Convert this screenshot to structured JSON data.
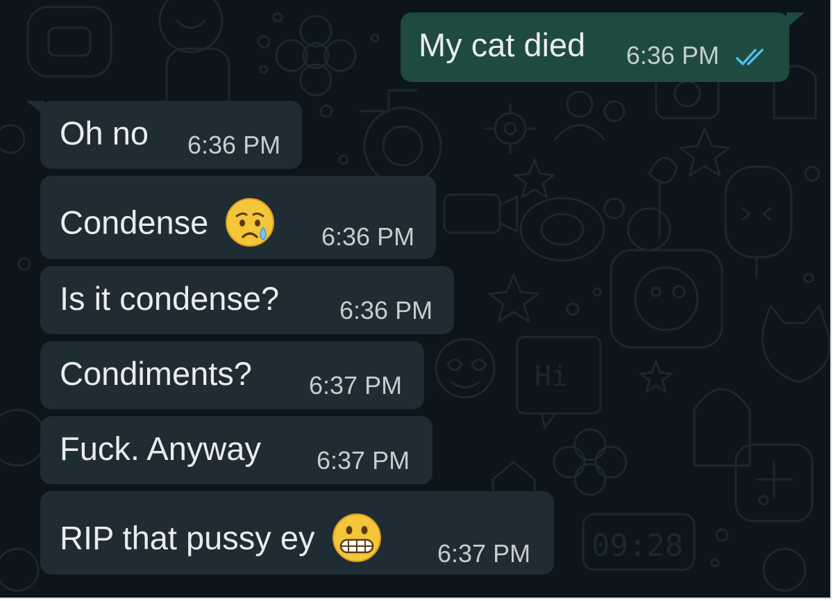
{
  "messages": [
    {
      "direction": "out",
      "text": "My cat died",
      "time": "6:36 PM",
      "status": "read",
      "status_icon": "double-check-icon",
      "status_color": "#53bdeb"
    },
    {
      "direction": "in",
      "text": "Oh no",
      "time": "6:36 PM"
    },
    {
      "direction": "in",
      "text": "Condense",
      "time": "6:36 PM",
      "emoji": "crying-face-emoji"
    },
    {
      "direction": "in",
      "text": "Is it condense?",
      "time": "6:36 PM"
    },
    {
      "direction": "in",
      "text": "Condiments?",
      "time": "6:37 PM"
    },
    {
      "direction": "in",
      "text": "Fuck. Anyway",
      "time": "6:37 PM"
    },
    {
      "direction": "in",
      "text": "RIP that pussy ey",
      "time": "6:37 PM",
      "emoji": "grimacing-face-emoji"
    }
  ],
  "colors": {
    "background": "#0c151b",
    "incoming_bubble": "#202c33",
    "outgoing_bubble": "#1f4a40",
    "text": "#e9edef",
    "timestamp": "#c7cdd1",
    "read_ticks": "#53bdeb"
  }
}
